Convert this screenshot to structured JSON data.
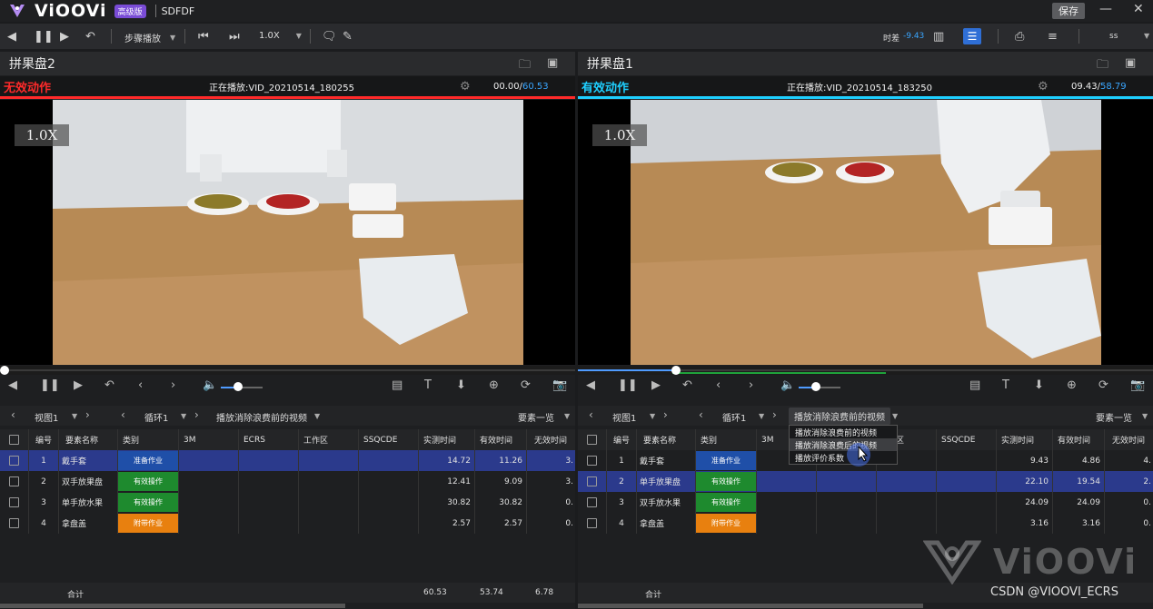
{
  "app": {
    "logo_text": "ViOOVi",
    "edition_badge": "高级版",
    "project_name": "SDFDF",
    "save_label": "保存",
    "minimize_glyph": "—",
    "close_glyph": "✕"
  },
  "toolbar": {
    "step_play_label": "步骤播放",
    "speed_label": "1.0X",
    "timer_label": "时差",
    "timer_value": "-9.43",
    "user_label": "ss"
  },
  "panes": [
    {
      "title": "拼果盘2",
      "status_label": "无效动作",
      "status_color": "#ff2a2a",
      "now_playing": "正在播放:VID_20210514_180255",
      "time_current": "00.00/",
      "time_total": "60.53",
      "speed_tag": "1.0X",
      "progress_fraction": 0.0,
      "volume_fraction": 0.42,
      "nav": {
        "view_label": "视图1",
        "cycle_label": "循环1",
        "play_mode_label": "播放消除浪费前的视频",
        "elements_label": "要素一览"
      },
      "columns": [
        "编号",
        "要素名称",
        "类别",
        "3M",
        "ECRS",
        "工作区",
        "SSQCDE",
        "实测时间",
        "有效时间",
        "无效时间"
      ],
      "rows": [
        {
          "no": "1",
          "name": "戴手套",
          "category": "准备作业",
          "cat_color": "#1f4fa8",
          "measured": "14.72",
          "effective": "11.26",
          "invalid": "3.",
          "selected": true
        },
        {
          "no": "2",
          "name": "双手放果盘",
          "category": "有效操作",
          "cat_color": "#1e8a2e",
          "measured": "12.41",
          "effective": "9.09",
          "invalid": "3.",
          "selected": false
        },
        {
          "no": "3",
          "name": "单手放水果",
          "category": "有效操作",
          "cat_color": "#1e8a2e",
          "measured": "30.82",
          "effective": "30.82",
          "invalid": "0.",
          "selected": false
        },
        {
          "no": "4",
          "name": "拿盘盖",
          "category": "附带作业",
          "cat_color": "#e8800f",
          "measured": "2.57",
          "effective": "2.57",
          "invalid": "0.",
          "selected": false
        }
      ],
      "total_label": "合计",
      "total_measured": "60.53",
      "total_effective": "53.74",
      "total_invalid": "6.78"
    },
    {
      "title": "拼果盘1",
      "status_label": "有效动作",
      "status_color": "#1ecfff",
      "now_playing": "正在播放:VID_20210514_183250",
      "time_current": "09.43/",
      "time_total": "58.79",
      "speed_tag": "1.0X",
      "progress_fraction": 0.165,
      "volume_fraction": 0.42,
      "nav": {
        "view_label": "视图1",
        "cycle_label": "循环1",
        "play_mode_label": "播放消除浪费前的视频",
        "elements_label": "要素一览"
      },
      "columns": [
        "编号",
        "要素名称",
        "类别",
        "3M",
        "",
        "区",
        "SSQCDE",
        "实测时间",
        "有效时间",
        "无效时间"
      ],
      "rows": [
        {
          "no": "1",
          "name": "戴手套",
          "category": "准备作业",
          "cat_color": "#1f4fa8",
          "measured": "9.43",
          "effective": "4.86",
          "invalid": "4.",
          "selected": false
        },
        {
          "no": "2",
          "name": "单手放果盘",
          "category": "有效操作",
          "cat_color": "#1e8a2e",
          "measured": "22.10",
          "effective": "19.54",
          "invalid": "2.",
          "selected": true
        },
        {
          "no": "3",
          "name": "双手放水果",
          "category": "有效操作",
          "cat_color": "#1e8a2e",
          "measured": "24.09",
          "effective": "24.09",
          "invalid": "0.",
          "selected": false
        },
        {
          "no": "4",
          "name": "拿盘盖",
          "category": "附带作业",
          "cat_color": "#e8800f",
          "measured": "3.16",
          "effective": "3.16",
          "invalid": "0.",
          "selected": false
        }
      ],
      "total_label": "合计",
      "context_menu": [
        "播放消除浪费前的视频",
        "播放消除浪费后的视频",
        "播放评价系数"
      ]
    }
  ],
  "watermark": {
    "brand": "ViOOVi",
    "credit": "CSDN @VIOOVI_ECRS"
  }
}
